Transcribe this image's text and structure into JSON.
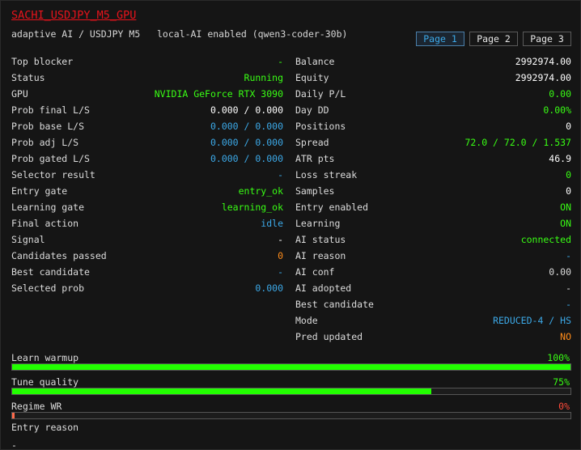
{
  "header": {
    "title": "SACHI_USDJPY_M5_GPU",
    "subtitle": "adaptive AI / USDJPY M5   local-AI enabled (qwen3-coder-30b)",
    "pages": [
      "Page 1",
      "Page 2",
      "Page 3"
    ],
    "active_page": 0
  },
  "left": [
    {
      "label": "Top blocker",
      "value": "-",
      "color": "green"
    },
    {
      "label": "Status",
      "value": "Running",
      "color": "green"
    },
    {
      "label": "GPU",
      "value": "NVIDIA GeForce RTX 3090",
      "color": "green"
    },
    {
      "label": "Prob final L/S",
      "value": "0.000 / 0.000",
      "color": "white"
    },
    {
      "label": "Prob base L/S",
      "value": "0.000 / 0.000",
      "color": "blue"
    },
    {
      "label": "Prob adj L/S",
      "value": "0.000 / 0.000",
      "color": "blue"
    },
    {
      "label": "Prob gated L/S",
      "value": "0.000 / 0.000",
      "color": "blue"
    },
    {
      "label": "Selector result",
      "value": "-",
      "color": "blue"
    },
    {
      "label": "Entry gate",
      "value": "entry_ok",
      "color": "green"
    },
    {
      "label": "Learning gate",
      "value": "learning_ok",
      "color": "green"
    },
    {
      "label": "Final action",
      "value": "idle",
      "color": "blue"
    },
    {
      "label": "Signal",
      "value": "-",
      "color": "white"
    },
    {
      "label": "Candidates passed",
      "value": "0",
      "color": "orange"
    },
    {
      "label": "Best candidate",
      "value": "-",
      "color": "blue"
    },
    {
      "label": "Selected prob",
      "value": "0.000",
      "color": "blue"
    }
  ],
  "right": [
    {
      "label": "Balance",
      "value": "2992974.00",
      "color": "white"
    },
    {
      "label": "Equity",
      "value": "2992974.00",
      "color": "white"
    },
    {
      "label": "Daily P/L",
      "value": "0.00",
      "color": "green"
    },
    {
      "label": "Day DD",
      "value": "0.00%",
      "color": "green"
    },
    {
      "label": "Positions",
      "value": "0",
      "color": "white"
    },
    {
      "label": "Spread",
      "value": "72.0 / 72.0 / 1.537",
      "color": "green"
    },
    {
      "label": "ATR pts",
      "value": "46.9",
      "color": "white"
    },
    {
      "label": "Loss streak",
      "value": "0",
      "color": "green"
    },
    {
      "label": "Samples",
      "value": "0",
      "color": "white"
    },
    {
      "label": "Entry enabled",
      "value": "ON",
      "color": "green"
    },
    {
      "label": "Learning",
      "value": "ON",
      "color": "green"
    },
    {
      "label": "AI status",
      "value": "connected",
      "color": "green"
    },
    {
      "label": "AI reason",
      "value": "-",
      "color": "blue"
    },
    {
      "label": "AI conf",
      "value": "0.00",
      "color": "dash"
    },
    {
      "label": "AI adopted",
      "value": "-",
      "color": "dash"
    },
    {
      "label": "Best candidate",
      "value": "-",
      "color": "blue"
    },
    {
      "label": "Mode",
      "value": "REDUCED-4 / HS",
      "color": "blue"
    },
    {
      "label": "Pred updated",
      "value": "NO",
      "color": "orange"
    }
  ],
  "bars": [
    {
      "label": "Learn warmup",
      "pct_text": "100%",
      "fraction": 1.0,
      "color": "green"
    },
    {
      "label": "Tune quality",
      "pct_text": "75%",
      "fraction": 0.75,
      "color": "green"
    },
    {
      "label": "Regime WR",
      "pct_text": "0%",
      "fraction": 0.0,
      "color": "red"
    }
  ],
  "entry_reason": {
    "label": "Entry reason",
    "value": "-"
  }
}
